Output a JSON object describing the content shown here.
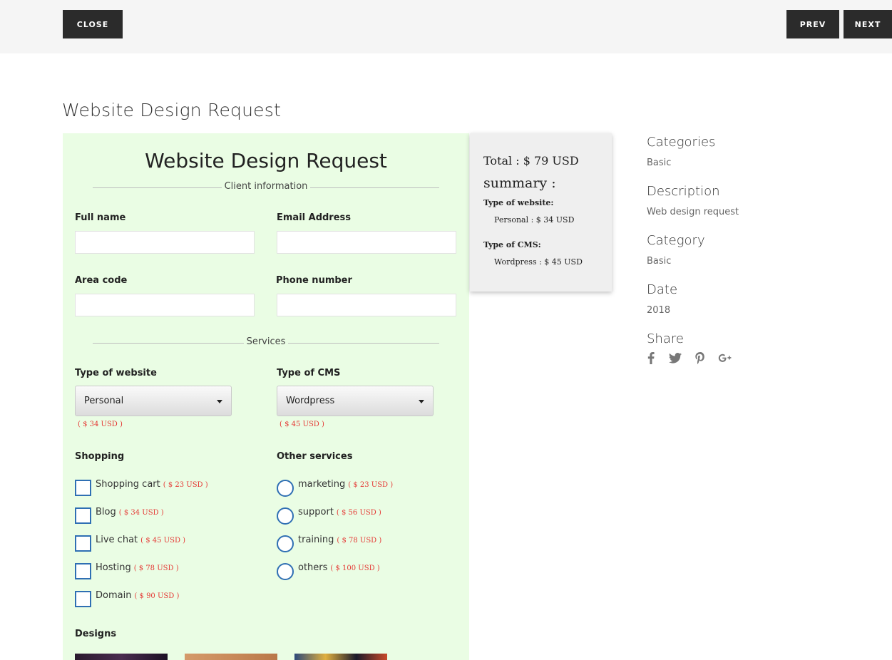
{
  "nav": {
    "close_label": "CLOSE",
    "prev_label": "PREV",
    "next_label": "NEXT"
  },
  "page_title": "Website Design Request",
  "form": {
    "title": "Website Design Request",
    "client_section": "Client information",
    "full_name_label": "Full name",
    "email_label": "Email Address",
    "area_code_label": "Area code",
    "phone_label": "Phone number",
    "services_section": "Services",
    "type_website_label": "Type of website",
    "type_website_value": "Personal",
    "type_website_price": "( $ 34 USD )",
    "type_cms_label": "Type of CMS",
    "type_cms_value": "Wordpress",
    "type_cms_price": "( $ 45 USD )",
    "shopping_label": "Shopping",
    "shopping_items": [
      {
        "label": "Shopping cart",
        "price": "( $ 23 USD )"
      },
      {
        "label": "Blog",
        "price": "( $ 34 USD )"
      },
      {
        "label": "Live chat",
        "price": "( $ 45 USD )"
      },
      {
        "label": "Hosting",
        "price": "( $ 78 USD )"
      },
      {
        "label": "Domain",
        "price": "( $ 90 USD )"
      }
    ],
    "other_label": "Other services",
    "other_items": [
      {
        "label": "marketing",
        "price": "( $ 23 USD )"
      },
      {
        "label": "support",
        "price": "( $ 56 USD )"
      },
      {
        "label": "training",
        "price": "( $ 78 USD )"
      },
      {
        "label": "others",
        "price": "( $ 100 USD )"
      }
    ],
    "designs_label": "Designs"
  },
  "summary": {
    "total": "Total : $ 79 USD",
    "title": "summary :",
    "website_head": "Type of website:",
    "website_item": "Personal : $ 34 USD",
    "cms_head": "Type of CMS:",
    "cms_item": "Wordpress : $ 45 USD"
  },
  "meta": {
    "categories_label": "Categories",
    "categories_value": "Basic",
    "description_label": "Description",
    "description_value": "Web design request",
    "category_label": "Category",
    "category_value": "Basic",
    "date_label": "Date",
    "date_value": "2018",
    "share_label": "Share",
    "share_icons": [
      "facebook-icon",
      "twitter-icon",
      "pinterest-icon",
      "google-plus-icon"
    ]
  },
  "colors": {
    "form_bg": "#eafde4",
    "price_red": "#e53935",
    "control_blue": "#2f6fb3",
    "nav_button": "#2b2b2b"
  }
}
